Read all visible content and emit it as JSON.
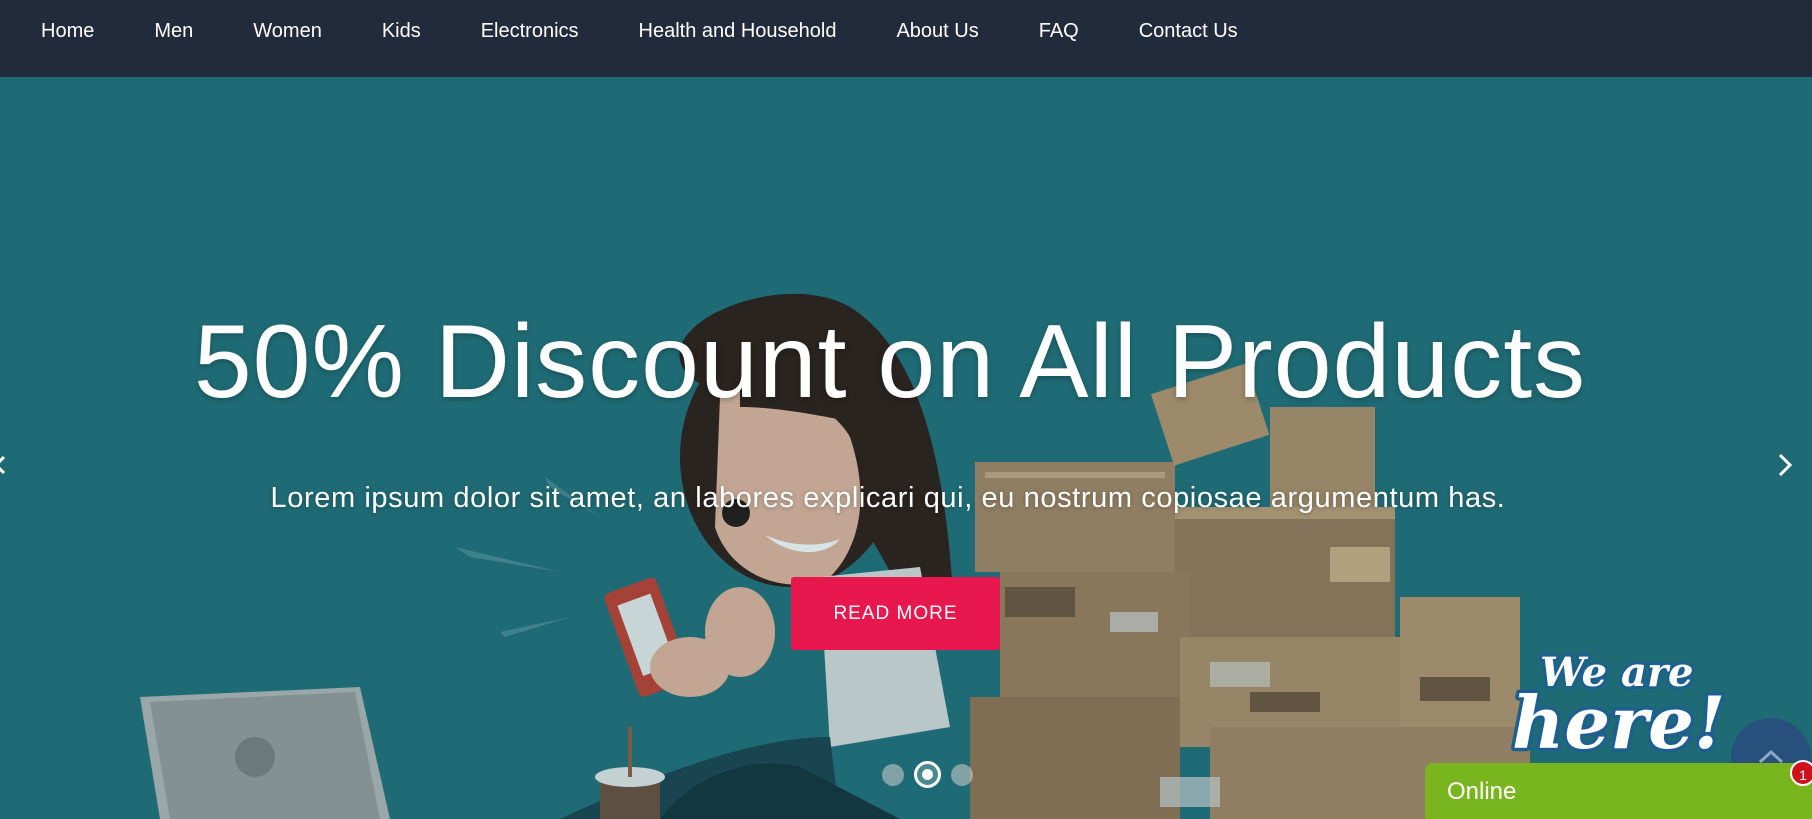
{
  "nav": {
    "items": [
      {
        "label": "Home"
      },
      {
        "label": "Men"
      },
      {
        "label": "Women"
      },
      {
        "label": "Kids"
      },
      {
        "label": "Electronics"
      },
      {
        "label": "Health and Household"
      },
      {
        "label": "About Us"
      },
      {
        "label": "FAQ"
      },
      {
        "label": "Contact Us"
      }
    ]
  },
  "hero": {
    "title": "50% Discount on All Products",
    "subtitle": "Lorem ipsum dolor sit amet, an labores explicari qui, eu nostrum copiosae argumentum has.",
    "button_label": "READ MORE",
    "active_slide": 2,
    "slide_count": 3
  },
  "widget": {
    "banner_text": "We are here!",
    "chat_status": "Online",
    "unread_count": "1"
  },
  "colors": {
    "nav_bg": "#222b3b",
    "hero_bg": "#1f6c76",
    "button_bg": "#e8184f",
    "chat_bg": "#79b51f",
    "scroll_top_bg": "#27507c",
    "badge_bg": "#d0101b"
  },
  "icons": {
    "next": "chevron-right-icon",
    "prev": "chevron-left-icon",
    "scroll_top": "chevron-up-icon"
  }
}
